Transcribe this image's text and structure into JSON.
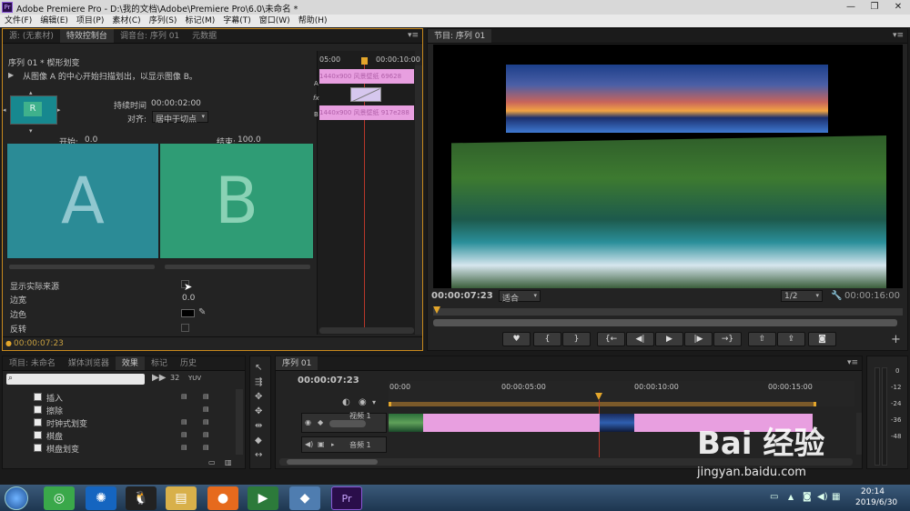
{
  "window": {
    "title": "Adobe Premiere Pro - D:\\我的文档\\Adobe\\Premiere Pro\\6.0\\未命名 *",
    "app_icon": "Pr"
  },
  "menu": [
    "文件(F)",
    "编辑(E)",
    "项目(P)",
    "素材(C)",
    "序列(S)",
    "标记(M)",
    "字幕(T)",
    "窗口(W)",
    "帮助(H)"
  ],
  "source_panel": {
    "tabs": [
      "源: (无素材)",
      "特效控制台",
      "调音台: 序列 01",
      "元数据"
    ],
    "active_tab": 1,
    "header": "序列 01 * 楔形划变",
    "description": "从图像 A 的中心开始扫描划出，以显示图像 B。",
    "duration_label": "持续时间",
    "duration_value": "00:00:02:00",
    "align_label": "对齐:",
    "align_value": "居中于切点",
    "start_label": "开始:",
    "start_value": "0.0",
    "end_label": "结束:",
    "end_value": "100.0",
    "preview_a": "A",
    "preview_b": "B",
    "show_actual_sources": "显示实际来源",
    "border_width_label": "边宽",
    "border_width_value": "0.0",
    "border_color_label": "边色",
    "reverse_label": "反转",
    "timecode": "00:00:07:23",
    "mini_timeline": {
      "time_start": "05:00",
      "time_end": "00:00:10:00",
      "track_a": "A",
      "track_b": "B",
      "fx": "fx",
      "clip_a_label": "1440x900 风景壁纸 69628",
      "clip_b_label": "1440x900 风景壁纸 917e288"
    }
  },
  "program_monitor": {
    "tab": "节目: 序列 01",
    "timecode": "00:00:07:23",
    "fit_value": "适合",
    "resolution": "1/2",
    "duration": "00:00:16:00",
    "transport_icons": [
      "marker-icon",
      "mark-in-icon",
      "mark-out-icon",
      "go-to-in-icon",
      "step-back-icon",
      "play-icon",
      "step-forward-icon",
      "go-to-out-icon",
      "lift-icon",
      "extract-icon",
      "export-frame-icon"
    ]
  },
  "project_panel": {
    "tabs": [
      "项目: 未命名",
      "媒体浏览器",
      "效果",
      "标记",
      "历史"
    ],
    "active_tab": 2,
    "items": [
      "插入",
      "擦除",
      "时钟式划变",
      "棋盘",
      "棋盘划变"
    ]
  },
  "timeline": {
    "tab": "序列 01",
    "timecode": "00:00:07:23",
    "ruler": [
      "00:00",
      "00:00:05:00",
      "00:00:10:00",
      "00:00:15:00"
    ],
    "video_track": "视频 1",
    "audio_track": "音频 1"
  },
  "audio_meter": {
    "labels": [
      "0",
      "-12",
      "-24",
      "-36",
      "-48"
    ]
  },
  "taskbar": {
    "time": "20:14",
    "date": "2019/6/30"
  },
  "watermark": {
    "brand": "Bai 经验",
    "url": "jingyan.baidu.com"
  }
}
